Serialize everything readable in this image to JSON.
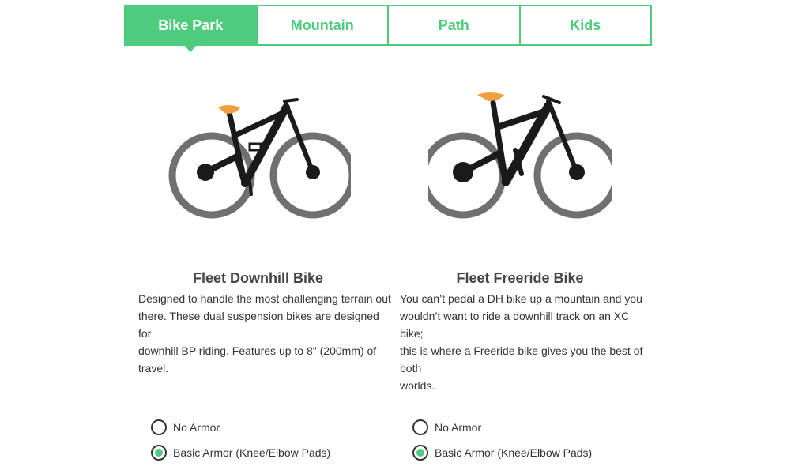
{
  "tabs": [
    {
      "label": "Bike Park",
      "active": true
    },
    {
      "label": "Mountain",
      "active": false
    },
    {
      "label": "Path",
      "active": false
    },
    {
      "label": "Kids",
      "active": false
    }
  ],
  "colors": {
    "accent": "#4ecb7c",
    "seat": "#f0a040",
    "frame": "#1a1a1a",
    "tire": "#707070"
  },
  "bikes": [
    {
      "icon": "downhill-bike-image",
      "title": "Fleet Downhill Bike",
      "desc_lines": [
        "Designed to handle the most challenging terrain out",
        "there. These dual suspension bikes are designed for",
        "downhill BP riding. Features up to 8\" (200mm) of travel."
      ],
      "options": [
        {
          "label": "No Armor",
          "checked": false
        },
        {
          "label": "Basic Armor (Knee/Elbow Pads)",
          "checked": true
        }
      ]
    },
    {
      "icon": "freeride-bike-image",
      "title": "Fleet Freeride Bike",
      "desc_lines": [
        "You can’t pedal a DH bike up a mountain and you",
        "wouldn’t want to ride a downhill track on an XC bike;",
        "this is where a Freeride bike gives you the best of both",
        "worlds."
      ],
      "options": [
        {
          "label": "No Armor",
          "checked": false
        },
        {
          "label": "Basic Armor (Knee/Elbow Pads)",
          "checked": true
        }
      ]
    }
  ]
}
